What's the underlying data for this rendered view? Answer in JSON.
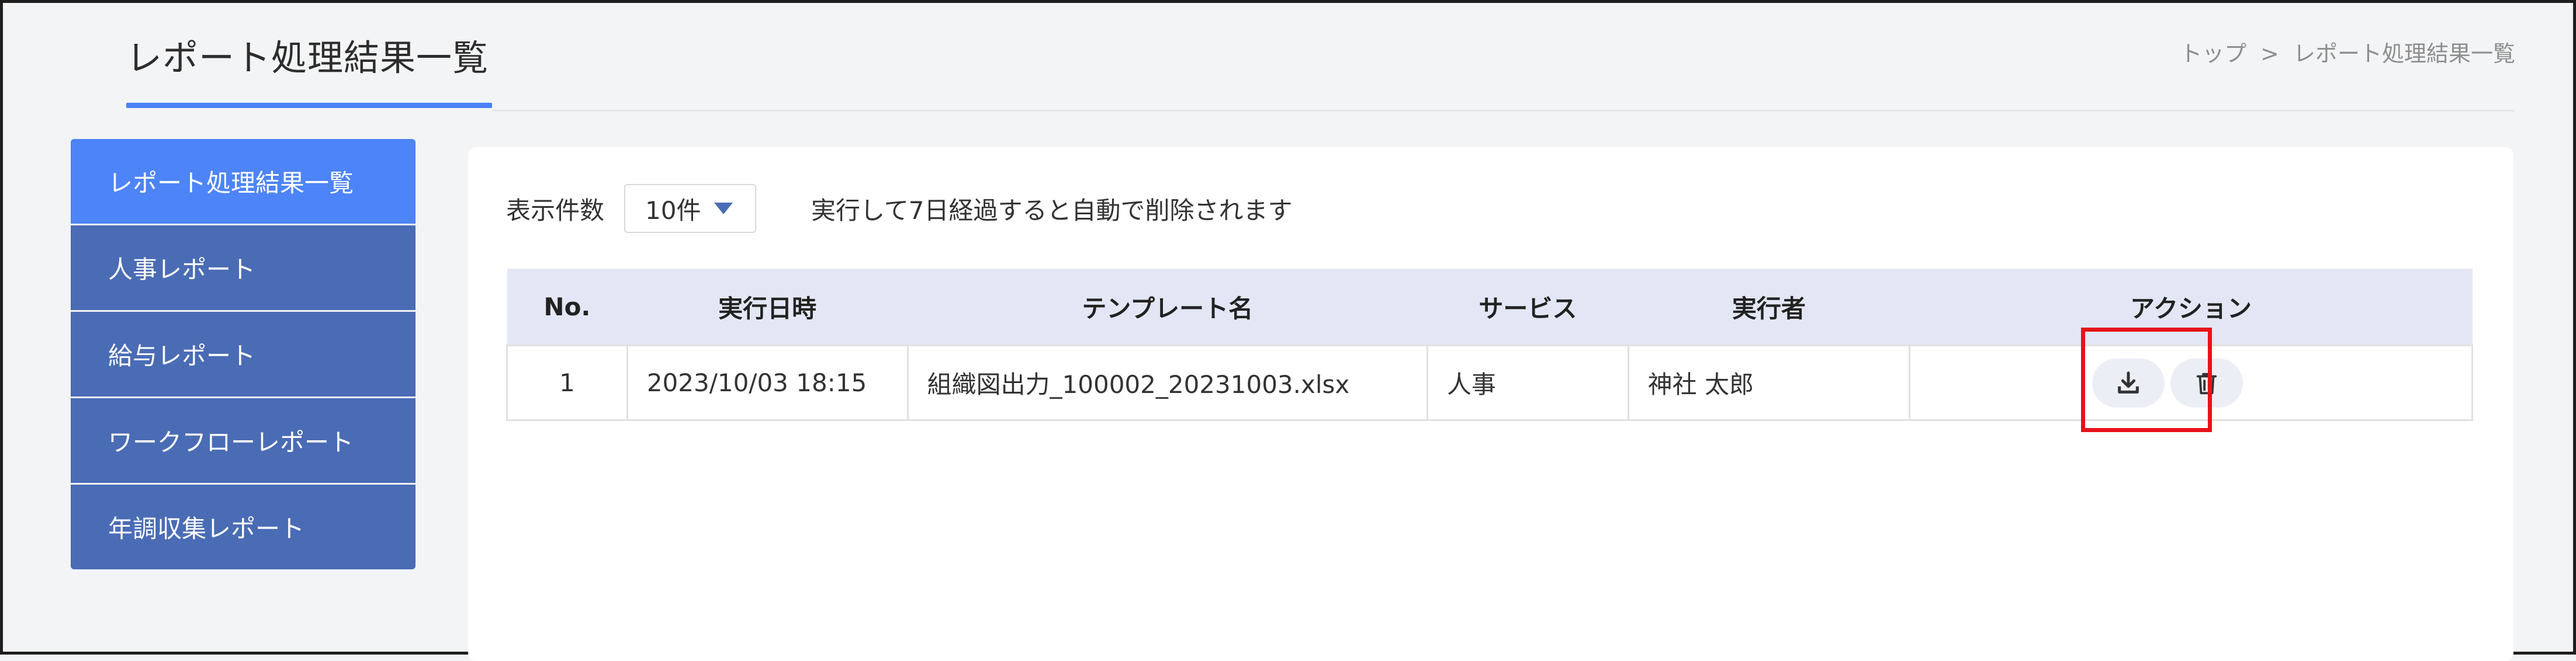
{
  "header": {
    "title": "レポート処理結果一覧",
    "breadcrumb": {
      "home": "トップ",
      "separator": ">",
      "current": "レポート処理結果一覧"
    }
  },
  "sidebar": {
    "items": [
      {
        "label": "レポート処理結果一覧",
        "active": true
      },
      {
        "label": "人事レポート",
        "active": false
      },
      {
        "label": "給与レポート",
        "active": false
      },
      {
        "label": "ワークフローレポート",
        "active": false
      },
      {
        "label": "年調収集レポート",
        "active": false
      }
    ]
  },
  "controls": {
    "page_size_label": "表示件数",
    "page_size_value": "10件",
    "notice": "実行して7日経過すると自動で削除されます"
  },
  "table": {
    "headers": [
      "No.",
      "実行日時",
      "テンプレート名",
      "サービス",
      "実行者",
      "アクション"
    ],
    "rows": [
      {
        "no": "1",
        "executed_at": "2023/10/03 18:15",
        "template": "組織図出力_100002_20231003.xlsx",
        "service": "人事",
        "executor": "神社 太郎"
      }
    ]
  },
  "icons": {
    "download": "download-icon",
    "delete": "trash-icon"
  },
  "colors": {
    "accent": "#4d84f7",
    "sidebar": "#4a6cb5",
    "table_header": "#e3e7f5",
    "highlight": "#e8121a"
  }
}
